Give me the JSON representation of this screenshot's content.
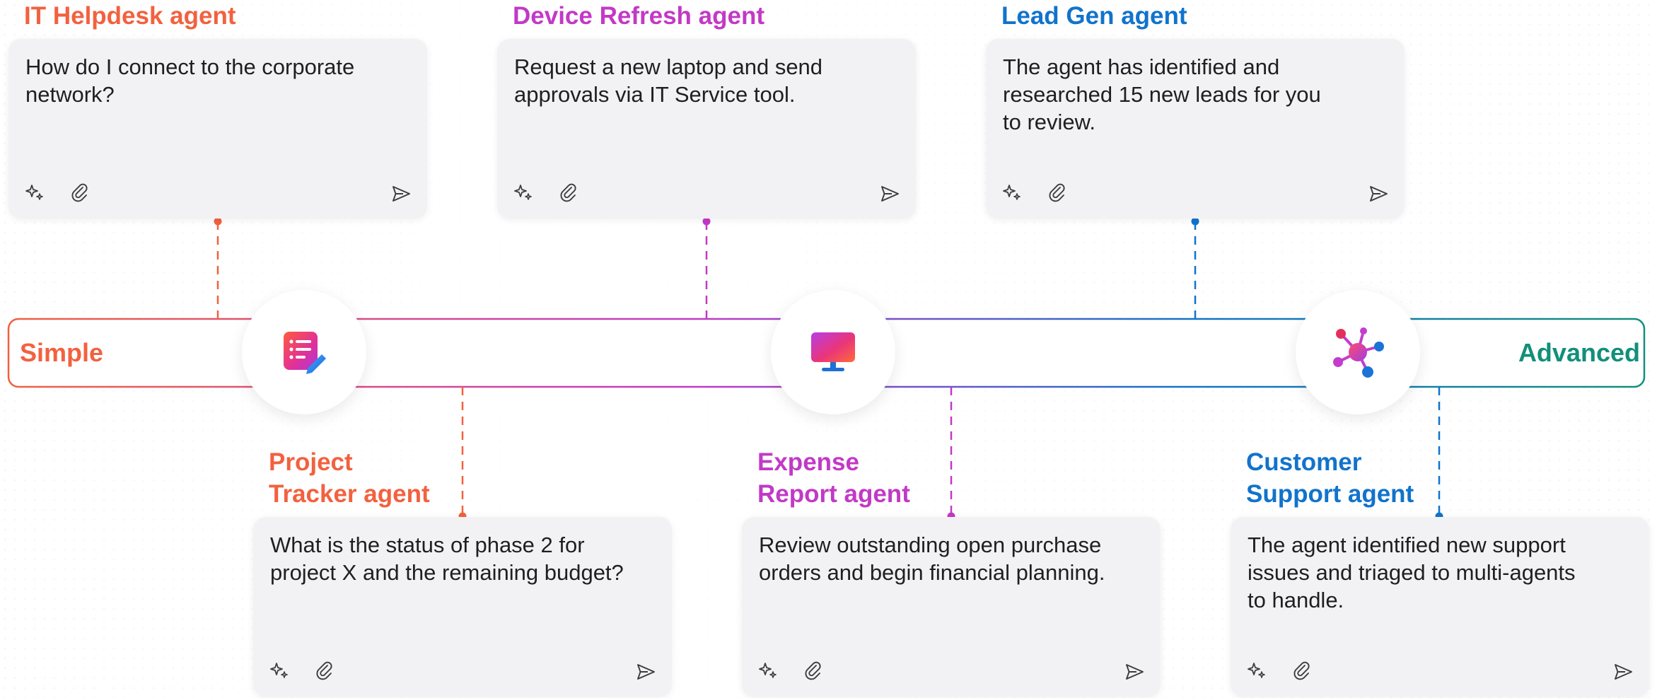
{
  "colors": {
    "simple": "#f2613f",
    "purple": "#c239c6",
    "blue": "#1173cc",
    "advanced": "#128f7a"
  },
  "track": {
    "start_label": "Simple",
    "end_label": "Advanced",
    "stage_icons": [
      "checklist-edit-icon",
      "monitor-icon",
      "network-hub-icon"
    ]
  },
  "agents": [
    {
      "title": "IT Helpdesk agent",
      "prompt": "How do I connect to the corporate\nnetwork?"
    },
    {
      "title": "Device Refresh agent",
      "prompt": "Request a new laptop and send\napprovals via IT Service tool."
    },
    {
      "title": "Lead Gen agent",
      "prompt": "The agent has identified and\nresearched 15 new leads for you\nto review."
    },
    {
      "title": "Project\nTracker agent",
      "prompt": "What is the status of phase 2 for\nproject X and the remaining budget?"
    },
    {
      "title": "Expense\nReport agent",
      "prompt": "Review outstanding open purchase\norders and begin financial planning."
    },
    {
      "title": "Customer\nSupport agent",
      "prompt": "The agent identified new support\nissues and triaged to multi-agents\nto handle."
    }
  ],
  "card_tools": [
    "sparkle-icon",
    "paperclip-icon",
    "send-icon"
  ]
}
